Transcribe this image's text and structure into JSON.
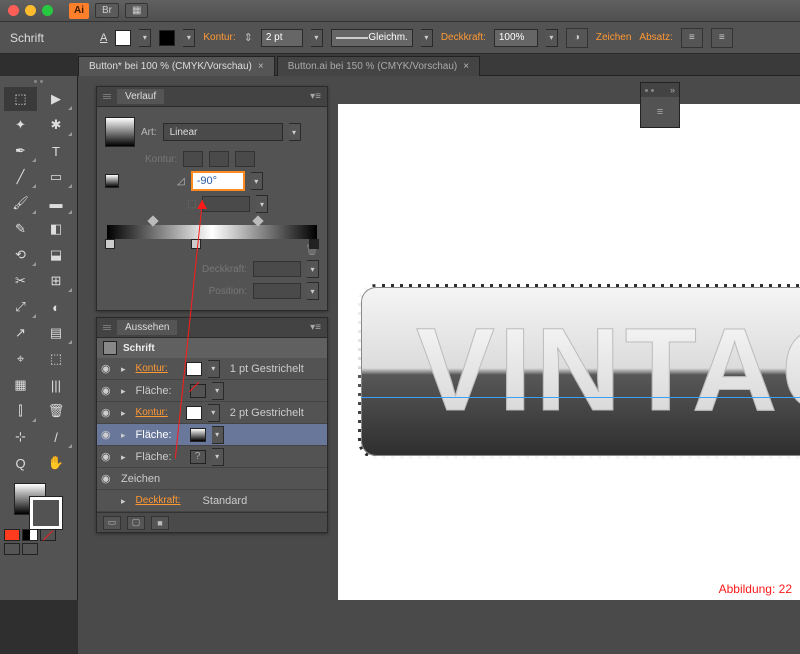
{
  "titlebar": {
    "app": "Ai",
    "br": "Br",
    "grid": "▦"
  },
  "control": {
    "label": "Schrift",
    "kontur": "Kontur:",
    "stroke_w": "2 pt",
    "dash": "Gleichm.",
    "deckkraft": "Deckkraft:",
    "opacity": "100%",
    "zeichen": "Zeichen",
    "absatz": "Absatz:"
  },
  "tabs": [
    {
      "label": "Button* bei 100 % (CMYK/Vorschau)"
    },
    {
      "label": "Button.ai bei 150 % (CMYK/Vorschau)"
    }
  ],
  "tools": [
    "⬚",
    "▶",
    "✦",
    "✱",
    "✒",
    "T",
    "╱",
    "▭",
    "🖌",
    "▬",
    "✎",
    "◧",
    "⟲",
    "⬓",
    "✂",
    "⊞",
    "⤢",
    "◐",
    "↗",
    "▤",
    "⌖",
    "⬚",
    "▦",
    "|||",
    "⫿",
    "🗑",
    "⊹",
    "/",
    "Q",
    "✋"
  ],
  "gradient": {
    "title": "Verlauf",
    "art": "Art:",
    "type": "Linear",
    "kontur": "Kontur:",
    "angle": "-90°",
    "deckkraft": "Deckkraft:",
    "position": "Position:"
  },
  "appearance": {
    "title": "Aussehen",
    "heading": "Schrift",
    "rows": [
      {
        "name": "Kontur:",
        "val": "1 pt Gestrichelt",
        "link": true,
        "sw": "white"
      },
      {
        "name": "Fläche:",
        "val": "",
        "link": false,
        "sw": "none"
      },
      {
        "name": "Kontur:",
        "val": "2 pt Gestrichelt",
        "link": true,
        "sw": "white"
      },
      {
        "name": "Fläche:",
        "val": "",
        "link": false,
        "sw": "grad",
        "sel": true
      },
      {
        "name": "Fläche:",
        "val": "",
        "link": false,
        "sw": "q"
      },
      {
        "name": "Zeichen",
        "val": "",
        "plain": true
      },
      {
        "name": "Deckkraft:",
        "val": "Standard",
        "link": true,
        "noeye": true
      }
    ]
  },
  "artwork": {
    "text": "VINTAG"
  },
  "caption": "Abbildung: 22"
}
